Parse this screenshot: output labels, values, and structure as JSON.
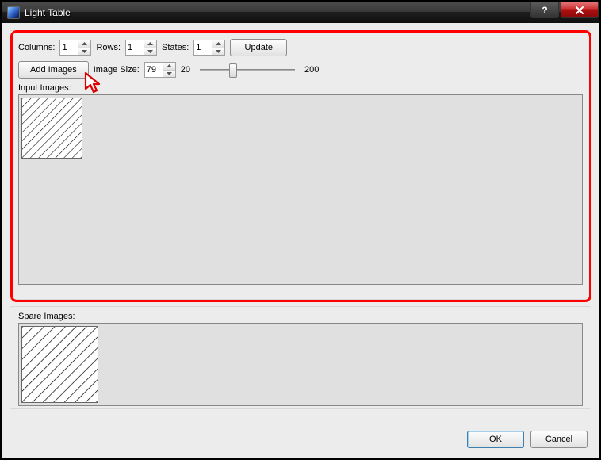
{
  "window": {
    "title": "Light Table"
  },
  "top_controls": {
    "columns_label": "Columns:",
    "columns_value": "1",
    "rows_label": "Rows:",
    "rows_value": "1",
    "states_label": "States:",
    "states_value": "1",
    "update_label": "Update",
    "add_images_label": "Add Images",
    "image_size_label": "Image Size:",
    "image_size_value": "79",
    "slider_min": "20",
    "slider_max": "200"
  },
  "panels": {
    "input_label": "Input Images:",
    "spare_label": "Spare Images:"
  },
  "buttons": {
    "ok": "OK",
    "cancel": "Cancel"
  }
}
